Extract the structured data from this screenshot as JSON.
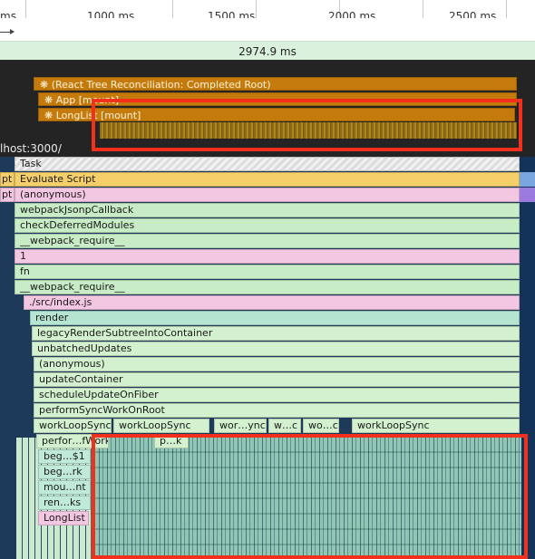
{
  "ruler": {
    "labels": [
      "ms",
      "1000 ms",
      "1500 ms",
      "2000 ms",
      "2500 ms"
    ]
  },
  "selection": {
    "duration": "2974.9 ms"
  },
  "timings": {
    "items": [
      "❋ (React Tree Reconciliation: Completed Root)",
      "❋ App [mount]",
      "❋ LongList [mount]"
    ]
  },
  "url": "lhost:3000/",
  "flame": {
    "left_labels": [
      "pt",
      "pt"
    ],
    "rows": [
      "Task",
      "Evaluate Script",
      "(anonymous)",
      "webpackJsonpCallback",
      "checkDeferredModules",
      "__webpack_require__",
      "1",
      "fn",
      "__webpack_require__",
      "./src/index.js",
      "render",
      "legacyRenderSubtreeIntoContainer",
      "unbatchedUpdates",
      "(anonymous)",
      "updateContainer",
      "scheduleUpdateOnFiber",
      "performSyncWorkOnRoot"
    ],
    "work_loop": [
      "workLoopSync",
      "workLoopSync",
      "wor…ync",
      "w…c",
      "wo…c",
      "workLoopSync"
    ],
    "deep_rows": [
      "perfor…fWork",
      "p…k",
      "beg…$1",
      "beg…rk",
      "mou…nt",
      "ren…ks",
      "LongList"
    ]
  },
  "colors": {
    "highlight": "#f2301c",
    "timing": "#c47b0b",
    "evaluate_script": "#f5cf6a",
    "js_green": "#c7ecc6",
    "js_pink": "#f3c6e1"
  }
}
